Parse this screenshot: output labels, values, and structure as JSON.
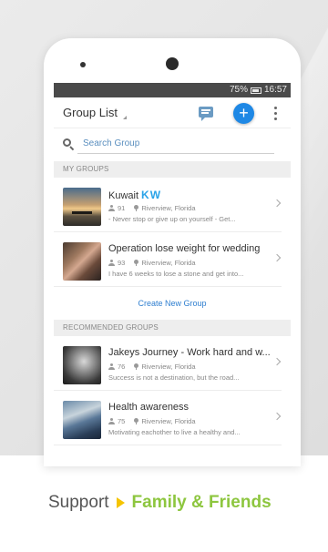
{
  "statusbar": {
    "battery": "75%",
    "time": "16:57"
  },
  "appbar": {
    "title": "Group List"
  },
  "search": {
    "placeholder": "Search Group"
  },
  "my_groups": {
    "header": "MY GROUPS",
    "items": [
      {
        "name": "Kuwait",
        "badge": "KW",
        "members": "91",
        "location": "Riverview, Florida",
        "description": "- Never stop or give up on yourself  - Get..."
      },
      {
        "name": "Operation lose weight  for wedding",
        "badge": "",
        "members": "93",
        "location": "Riverview, Florida",
        "description": "I have 6 weeks to lose a stone and get into..."
      }
    ],
    "create_label": "Create New Group"
  },
  "recommended": {
    "header": "RECOMMENDED GROUPS",
    "items": [
      {
        "name": "Jakeys Journey - Work hard and w...",
        "members": "76",
        "location": "Riverview, Florida",
        "description": "Success is not a destination, but the road..."
      },
      {
        "name": "Health awareness",
        "members": "75",
        "location": "Riverview, Florida",
        "description": "Motivating eachother to live a healthy and..."
      }
    ]
  },
  "tagline": {
    "prefix": "Support",
    "highlight": "Family & Friends"
  },
  "colors": {
    "accent": "#1e88e5",
    "badge": "#29a3e8",
    "tag_green": "#8dc63f",
    "arrow_yellow": "#f5c400"
  }
}
